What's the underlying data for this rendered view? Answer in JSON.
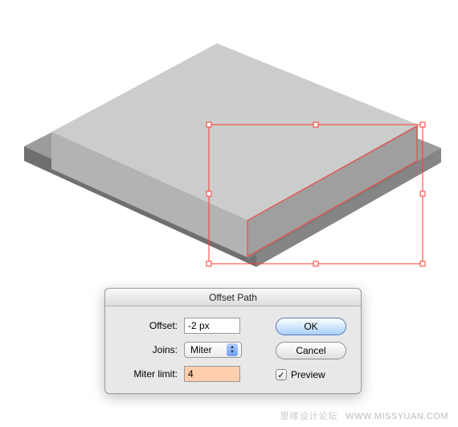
{
  "dialog": {
    "title": "Offset Path",
    "offset_label": "Offset:",
    "offset_value": "-2 px",
    "joins_label": "Joins:",
    "joins_value": "Miter",
    "miter_label": "Miter limit:",
    "miter_value": "4",
    "ok_label": "OK",
    "cancel_label": "Cancel",
    "preview_label": "Preview",
    "preview_checked": true
  },
  "watermark": {
    "cn": "思缘设计论坛",
    "url": "WWW.MISSYUAN.COM"
  },
  "selection_color": "#ff3a2f"
}
